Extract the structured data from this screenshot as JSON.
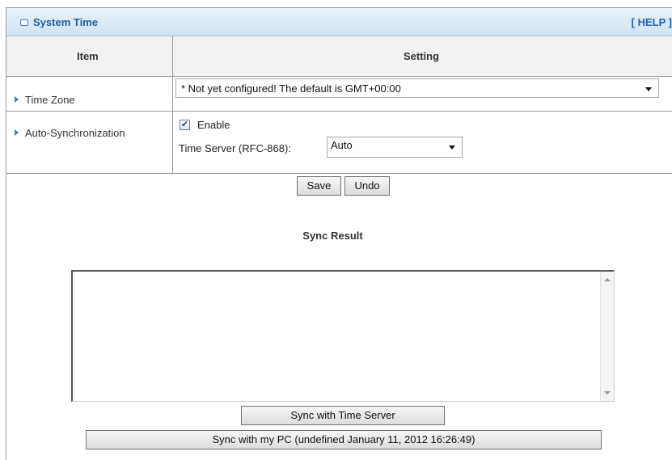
{
  "header": {
    "title": "System Time",
    "help_label": "[ HELP ]"
  },
  "table": {
    "col_item": "Item",
    "col_setting": "Setting"
  },
  "time_zone": {
    "label": "Time Zone",
    "selected": "* Not yet configured! The default is GMT+00:00"
  },
  "auto_sync": {
    "label": "Auto-Synchronization",
    "enable_label": "Enable",
    "enabled": true,
    "server_label": "Time Server (RFC-868):",
    "server_selected": "Auto"
  },
  "actions": {
    "save_label": "Save",
    "undo_label": "Undo"
  },
  "sync_result": {
    "title": "Sync Result",
    "content": ""
  },
  "sync_buttons": {
    "server_label": "Sync with Time Server",
    "pc_label": "Sync with my PC (undefined January 11, 2012 16:26:49)"
  },
  "icons": {
    "title_icon": "panel-icon",
    "row_arrow": "triangle-right-icon",
    "select_caret": "chevron-down-icon"
  },
  "colors": {
    "title_text": "#1f5f95",
    "title_bar": "#d8e9f6",
    "arrow": "#3a7fbf",
    "help_link": "#1f5fb5"
  }
}
